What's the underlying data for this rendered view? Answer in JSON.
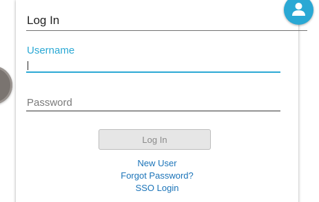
{
  "header": {
    "title": "Log In"
  },
  "form": {
    "username_label": "Username",
    "username_value": "",
    "password_placeholder": "Password",
    "password_value": "",
    "submit_label": "Log In"
  },
  "links": {
    "new_user": "New User",
    "forgot_password": "Forgot Password?",
    "sso_login": "SSO Login"
  },
  "icons": {
    "avatar": "user-icon"
  },
  "colors": {
    "accent": "#2aa8d4",
    "link": "#1a73b8",
    "button_bg": "#e6e6e6",
    "button_text": "#8a8a8a"
  }
}
